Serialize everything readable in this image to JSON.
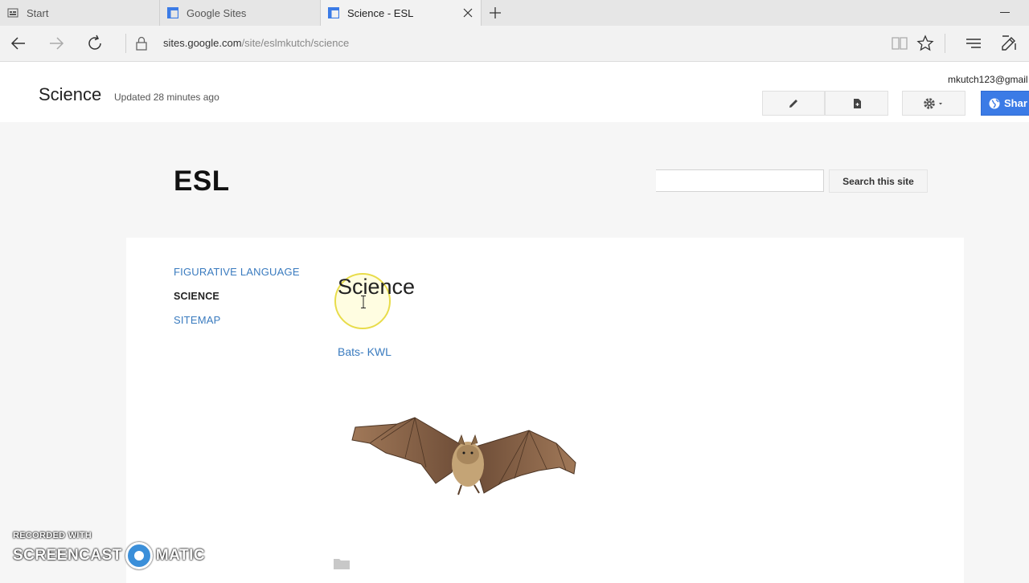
{
  "browser": {
    "tabs": [
      {
        "label": "Start",
        "icon": "start-page-icon",
        "active": false
      },
      {
        "label": "Google Sites",
        "icon": "google-sites-icon",
        "active": false
      },
      {
        "label": "Science - ESL",
        "icon": "google-sites-icon",
        "active": true
      }
    ],
    "url": {
      "host": "sites.google.com",
      "path": "/site/eslmkutch/science"
    }
  },
  "site_header": {
    "page_title": "Science",
    "updated": "Updated 28 minutes ago",
    "account": "mkutch123@gmail",
    "share_label": "Shar"
  },
  "site": {
    "name": "ESL",
    "search_button": "Search this site",
    "search_value": ""
  },
  "sidebar": {
    "items": [
      {
        "label": "FIGURATIVE LANGUAGE",
        "current": false
      },
      {
        "label": "SCIENCE",
        "current": true
      },
      {
        "label": "SITEMAP",
        "current": false
      }
    ]
  },
  "content": {
    "heading": "Science",
    "link": "Bats- KWL",
    "image": "bat-photo"
  },
  "watermark": {
    "line1": "RECORDED WITH",
    "left": "SCREENCAST",
    "right": "MATIC"
  },
  "colors": {
    "link": "#3a7bbf",
    "share": "#3b7be6",
    "cursor_highlight": "#e8dc4a"
  }
}
